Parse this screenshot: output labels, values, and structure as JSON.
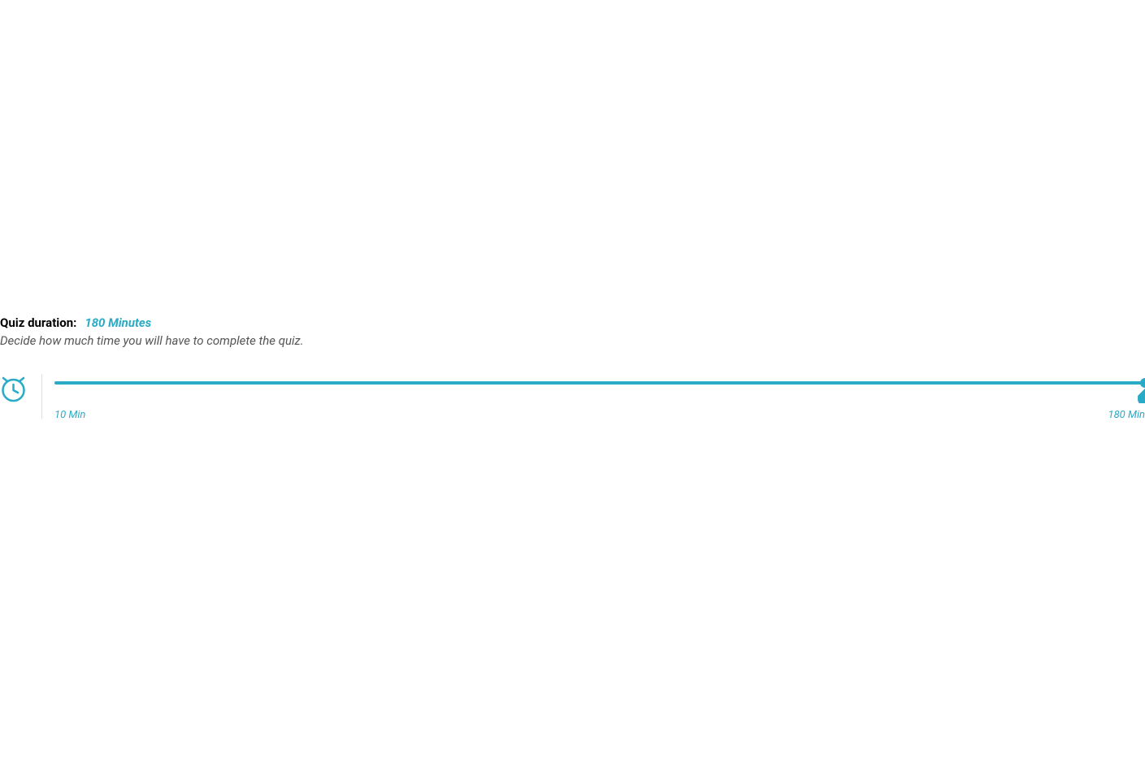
{
  "duration": {
    "label": "Quiz duration:",
    "value": "180 Minutes",
    "description": "Decide how much time you will have to complete the quiz.",
    "slider": {
      "min_label": "10 Min",
      "max_label": "180 Min",
      "min": 10,
      "max": 180,
      "current": 180
    }
  },
  "colors": {
    "accent": "#29abc7"
  }
}
